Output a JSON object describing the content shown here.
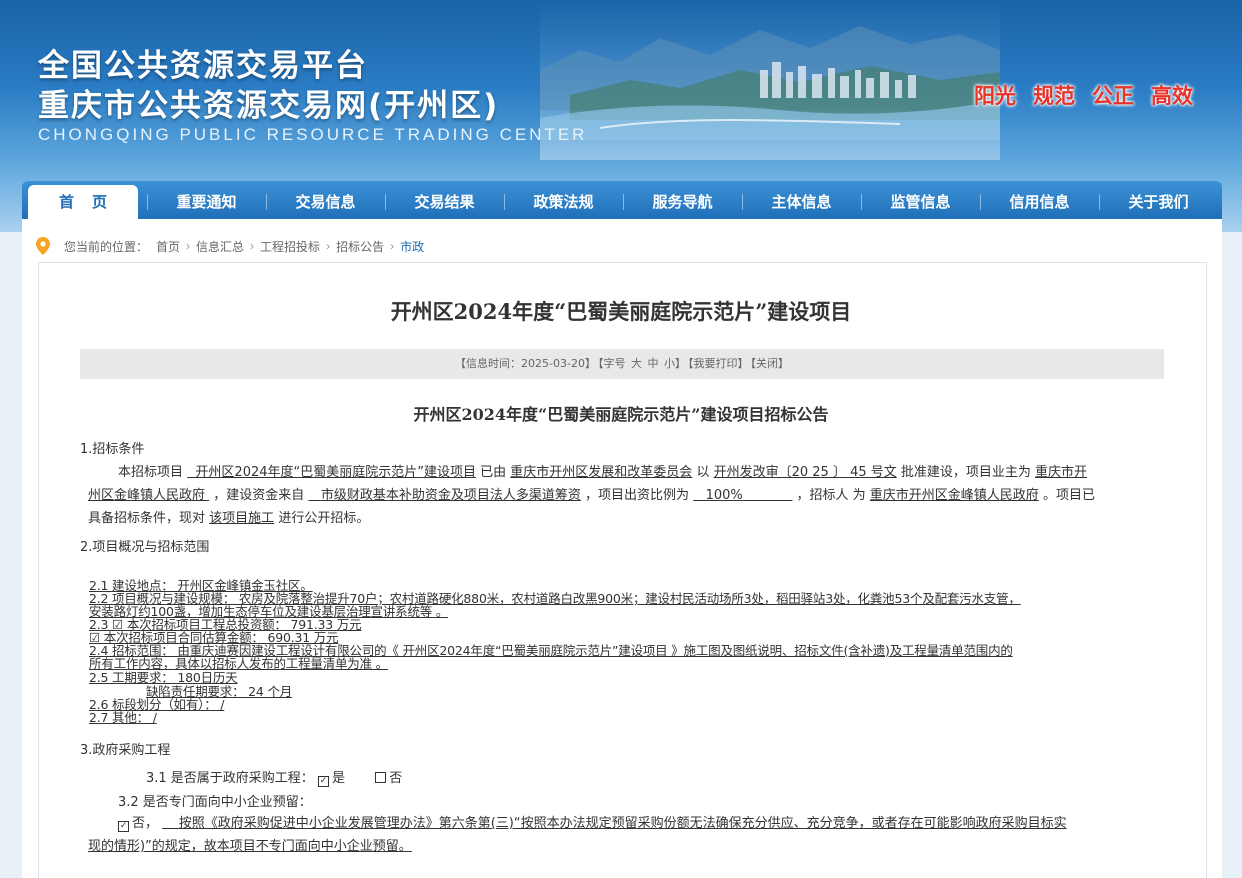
{
  "header": {
    "title_line1": "全国公共资源交易平台",
    "title_line2": "重庆市公共资源交易网(开州区)",
    "title_en": "CHONGQING PUBLIC RESOURCE TRADING CENTER",
    "slogans": [
      "阳光",
      "规范",
      "公正",
      "高效"
    ]
  },
  "nav": {
    "items": [
      "首页",
      "重要通知",
      "交易信息",
      "交易结果",
      "政策法规",
      "服务导航",
      "主体信息",
      "监管信息",
      "信用信息",
      "关于我们"
    ]
  },
  "breadcrumb": {
    "label": "您当前的位置：",
    "items": [
      "首页",
      "信息汇总",
      "工程招投标",
      "招标公告",
      "市政"
    ]
  },
  "article": {
    "title": "开州区2024年度“巴蜀美丽庭院示范片”建设项目",
    "info": {
      "time": "【信息时间：2025-03-20】",
      "font_label": "【字号",
      "font_large": "大",
      "font_medium": "中",
      "font_small": "小】",
      "print": "【我要打印】",
      "close": "【关闭】"
    },
    "notice_title": "开州区2024年度“巴蜀美丽庭院示范片”建设项目招标公告",
    "s1": {
      "heading": "1.招标条件",
      "p1a": "本招标项目",
      "p1_project": "开州区2024年度“巴蜀美丽庭院示范片”建设项目",
      "p1b": "已由",
      "p1_approver": "重庆市开州区发展和改革委员会",
      "p1c": "以",
      "p1_doc": "开州发改审〔20 25 〕 45 号文",
      "p1d": "批准建设，项目业主为",
      "p1_owner1": "重庆市开",
      "p1_owner2": "州区金峰镇人民政府",
      "p2a": "，建设资金来自",
      "p2_fund": "市级财政基本补助资金及项目法人多渠道筹资",
      "p2b": "，项目出资比例为",
      "p2_ratio": "100%",
      "p2c": "，招标人",
      "p2d": "为",
      "p2_tenderer": "重庆市开州区金峰镇人民政府",
      "p2e": "。项目已",
      "p3a": "具备招标条件，现对",
      "p3_scope": "该项目施工",
      "p3b": "进行公开招标。"
    },
    "s2": {
      "heading": "2.项目概况与招标范围",
      "l1": "2.1  建设地点：  开州区金峰镇金玉社区。",
      "l2": "2.2  项目概况与建设规模：       农房及院落整治提升70户；农村道路硬化880米，农村道路白改黑900米；建设村民活动场所3处，稻田驿站3处，化粪池53个及配套污水支管，",
      "l3": "安装路灯约100盏，增加生态停车位及建设基层治理宣讲系统等  。",
      "l4": "2.3  ☑ 本次招标项目工程总投资额：      791.33 万元",
      "l5": "☑ 本次招标项目合同估算金额：       690.31 万元",
      "l6": "2.4  招标范围：  由重庆迪赛因建设工程设计有限公司的《 开州区2024年度“巴蜀美丽庭院示范片”建设项目 》施工图及图纸说明、招标文件(含补遗)及工程量清单范围内的",
      "l7": "所有工作内容，具体以招标人发布的工程量清单为准 。",
      "l8": "2.5  工期要求：         180日历天",
      "l9": "缺陷责任期要求：        24 个月",
      "l10": "2.6  标段划分（如有）：       /",
      "l11": "2.7   其他：              /"
    },
    "s3": {
      "heading": "3.政府采购工程",
      "q1": "3.1  是否属于政府采购工程：",
      "q1_yes": "是",
      "q1_no": "否",
      "q2": "3.2  是否专门面向中小企业预留：",
      "q2_no": "否，",
      "q2_text1": "按照《政府采购促进中小企业发展管理办法》第六条第(三)“按照本办法规定预留采购份额无法确保充分供应、充分竞争，或者存在可能影响政府采购目标实",
      "q2_text2": "现的情形)”的规定，故本项目不专门面向中小企业预留。"
    }
  },
  "colors": {
    "primary": "#1e6db5",
    "slogan": "#e8332a",
    "info_bg": "#e8e8e8"
  }
}
